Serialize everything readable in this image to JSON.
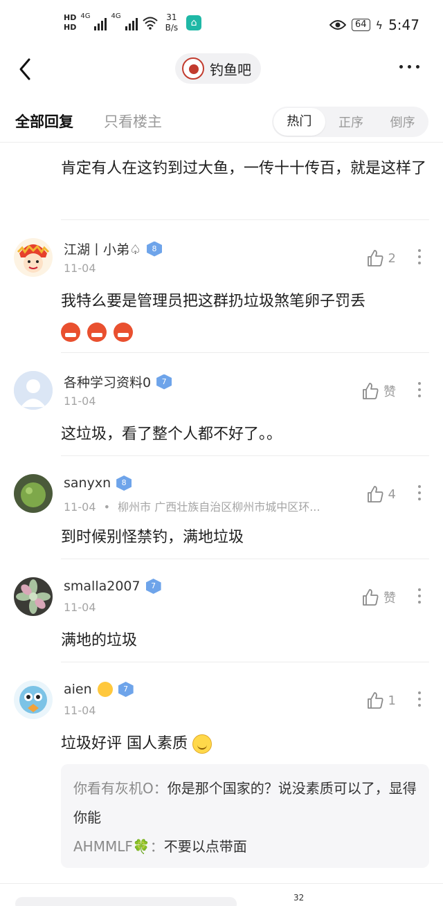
{
  "status_bar": {
    "hd1": "HD",
    "hd2": "HD",
    "net1": "4G",
    "net2": "4G",
    "speed_value": "31",
    "speed_unit": "B/s",
    "battery": "64",
    "time": "5:47"
  },
  "header": {
    "forum_name": "钓鱼吧"
  },
  "tabs": {
    "all_replies": "全部回复",
    "op_only": "只看楼主",
    "sort_hot": "热门",
    "sort_asc": "正序",
    "sort_desc": "倒序"
  },
  "top_text": "肯定有人在这钓到过大鱼，一传十十传百，就是这样了",
  "comments": [
    {
      "username": "江湖丨小弟♤",
      "level": "8",
      "date": "11-04",
      "likes": "2",
      "text": "我特么要是管理员把这群扔垃圾煞笔卵子罚丢"
    },
    {
      "username": "各种学习资料0",
      "level": "7",
      "date": "11-04",
      "likes": "赞",
      "text": "这垃圾，看了整个人都不好了。。"
    },
    {
      "username": "sanyxn",
      "level": "8",
      "date": "11-04",
      "location": "柳州市 广西壮族自治区柳州市城中区环...",
      "likes": "4",
      "text": "到时候别怪禁钓，满地垃圾"
    },
    {
      "username": "smalla2007",
      "level": "7",
      "date": "11-04",
      "likes": "赞",
      "text": "满地的垃圾"
    },
    {
      "username": "aien",
      "level": "7",
      "date": "11-04",
      "likes": "1",
      "text": "垃圾好评 国人素质"
    }
  ],
  "sub_replies": [
    {
      "user": "你看有灰机O：",
      "text": "你是那个国家的？说没素质可以了，显得你能"
    },
    {
      "user": "AHMMLF🍀：",
      "text": "不要以点带面"
    }
  ],
  "bottom": {
    "count": "32"
  },
  "colors": {
    "level_badge": "#6ea4ea",
    "muted_text": "#9a9a9a",
    "subreply_bg": "#f6f6f8"
  }
}
